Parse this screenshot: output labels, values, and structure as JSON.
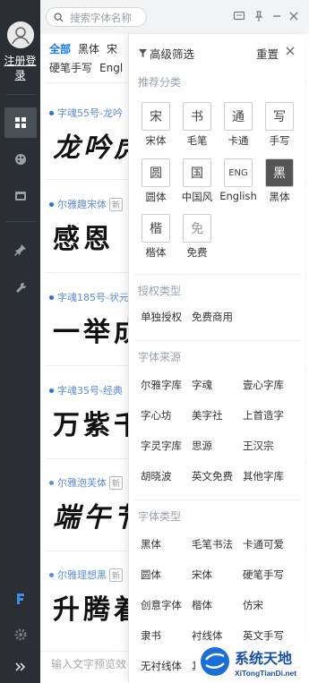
{
  "rail": {
    "login_label": "注册登录",
    "icons": [
      "grid-icon",
      "palette-icon",
      "folder-icon",
      "pin-icon",
      "wrench-icon",
      "brand-logo-icon",
      "gear-icon",
      "chevron-double-right-icon"
    ]
  },
  "topbar": {
    "search_placeholder": "搜索字体名称"
  },
  "tabs": {
    "row1": [
      "全部",
      "黑体",
      "宋"
    ],
    "row2": [
      "硬笔手写",
      "Engl"
    ]
  },
  "cards": [
    {
      "meta": "字魂55号-龙吟",
      "tag": "",
      "sample": "龙吟虎"
    },
    {
      "meta": "尔雅趣宋体",
      "tag": "新",
      "sample": "感恩"
    },
    {
      "meta": "字魂185号-状元",
      "tag": "",
      "sample": "一举成"
    },
    {
      "meta": "字魂35号-经典",
      "tag": "",
      "sample": "万紫千"
    },
    {
      "meta": "尔雅泡芙体",
      "tag": "新",
      "sample": "端午节"
    },
    {
      "meta": "尔雅理想黑",
      "tag": "新",
      "sample": "升腾着"
    }
  ],
  "bottom": {
    "placeholder": "输入文字预览效"
  },
  "panel": {
    "title": "高级筛选",
    "reset": "重置",
    "sections": {
      "recommend": "推荐分类",
      "license": "授权类型",
      "source": "字体来源",
      "type": "字体类型"
    },
    "categories": [
      {
        "glyph": "宋",
        "label": "宋体"
      },
      {
        "glyph": "书",
        "label": "毛笔"
      },
      {
        "glyph": "通",
        "label": "卡通"
      },
      {
        "glyph": "写",
        "label": "手写"
      },
      {
        "glyph": "圆",
        "label": "圆体"
      },
      {
        "glyph": "国",
        "label": "中国风"
      },
      {
        "glyph": "ENG",
        "label": "English"
      },
      {
        "glyph": "黑",
        "label": "黑体"
      },
      {
        "glyph": "楷",
        "label": "楷体"
      },
      {
        "glyph": "免",
        "label": "免费"
      }
    ],
    "license_options": [
      "单独授权",
      "免费商用"
    ],
    "source_options": [
      "尔雅字库",
      "字魂",
      "壹心字库",
      "字心坊",
      "美字社",
      "上首造字",
      "字灵字库",
      "思源",
      "王汉宗",
      "胡晓波",
      "英文免费",
      "其他字库"
    ],
    "type_options": [
      "黑体",
      "毛笔书法",
      "卡通可爱",
      "圆体",
      "宋体",
      "硬笔手写",
      "创意字体",
      "楷体",
      "仿宋",
      "隶书",
      "衬线体",
      "英文手写",
      "无衬线体",
      "其"
    ]
  },
  "watermark": {
    "cn": "系统天地",
    "url": "XiTongTianDi.net"
  },
  "colors": {
    "accent": "#1677ff",
    "rail_bg": "#2b2f33",
    "brand": "#3a8ee6"
  }
}
